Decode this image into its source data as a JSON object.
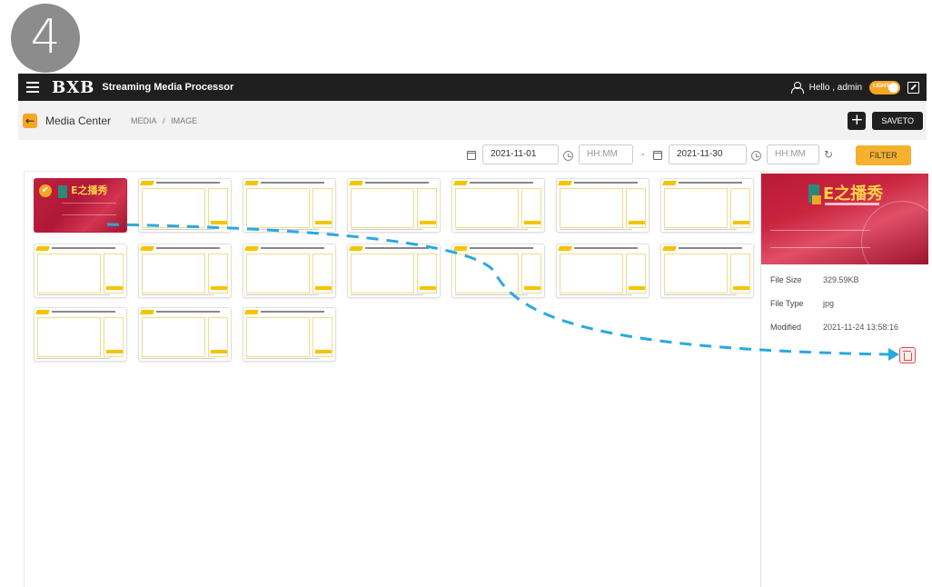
{
  "step": "4",
  "header": {
    "logo": "BXB",
    "app_title": "Streaming Media Processor",
    "greeting": "Hello , admin",
    "theme_toggle": "LIGHT"
  },
  "toolbar": {
    "back_icon": "←",
    "title": "Media Center",
    "breadcrumb": [
      "MEDIA",
      "/",
      "IMAGE"
    ],
    "add_icon": "+",
    "saveto_label": "SAVETO"
  },
  "filter": {
    "start_date": "2021-11-01",
    "start_time_placeholder": "HH:MM",
    "separator": "-",
    "end_date": "2021-11-30",
    "end_time_placeholder": "HH:MM",
    "refresh_icon": "↻",
    "filter_label": "FILTER"
  },
  "gallery": {
    "selected_index": 0,
    "selected_check": "✔",
    "selected_text": "E之播秀",
    "count": 17
  },
  "details": {
    "preview_title": "E之播秀",
    "rows": [
      {
        "label": "File Size",
        "value": "329.59KB"
      },
      {
        "label": "File Type",
        "value": "jpg"
      },
      {
        "label": "Modified",
        "value": "2021-11-24 13:58:16"
      }
    ]
  },
  "colors": {
    "accent": "#f5a623",
    "topbar": "#1f1f1f",
    "arrow": "#29a9e1",
    "danger": "#d9534f"
  }
}
